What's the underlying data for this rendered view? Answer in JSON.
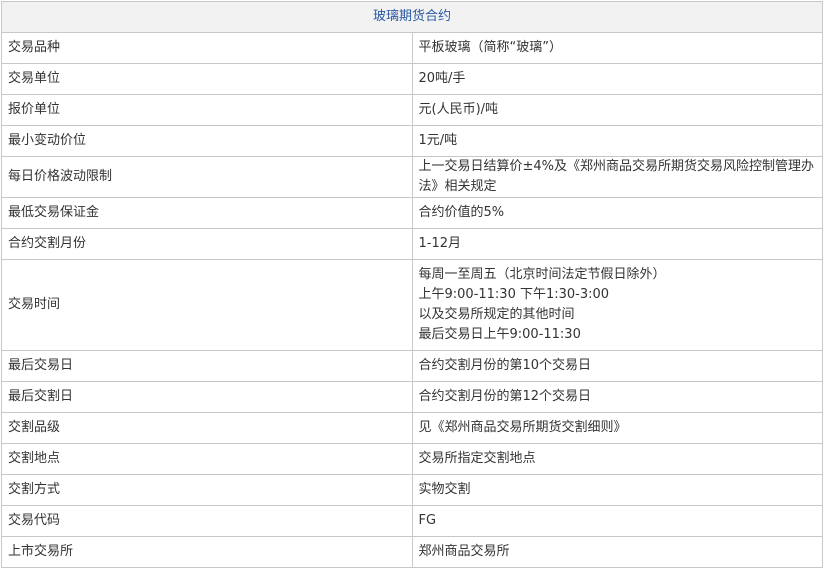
{
  "table": {
    "title": "玻璃期货合约",
    "rows": [
      {
        "label": "交易品种",
        "value": "平板玻璃（简称“玻璃”）"
      },
      {
        "label": "交易单位",
        "value": "20吨/手"
      },
      {
        "label": "报价单位",
        "value": "元(人民币)/吨"
      },
      {
        "label": "最小变动价位",
        "value": "1元/吨"
      },
      {
        "label": "每日价格波动限制",
        "value": "上一交易日结算价±4%及《郑州商品交易所期货交易风险控制管理办法》相关规定"
      },
      {
        "label": "最低交易保证金",
        "value": "合约价值的5%"
      },
      {
        "label": "合约交割月份",
        "value": "1-12月"
      }
    ],
    "trading_time": {
      "label": "交易时间",
      "lines": [
        "每周一至周五（北京时间法定节假日除外）",
        "上午9:00-11:30  下午1:30-3:00",
        "以及交易所规定的其他时间",
        "最后交易日上午9:00-11:30"
      ]
    },
    "rows_after": [
      {
        "label": "最后交易日",
        "value": "合约交割月份的第10个交易日"
      },
      {
        "label": "最后交割日",
        "value": "合约交割月份的第12个交易日"
      },
      {
        "label": "交割品级",
        "value": "见《郑州商品交易所期货交割细则》"
      },
      {
        "label": "交割地点",
        "value": "交易所指定交割地点"
      },
      {
        "label": "交割方式",
        "value": "实物交割"
      },
      {
        "label": "交易代码",
        "value": "FG"
      },
      {
        "label": "上市交易所",
        "value": "郑州商品交易所"
      }
    ]
  }
}
